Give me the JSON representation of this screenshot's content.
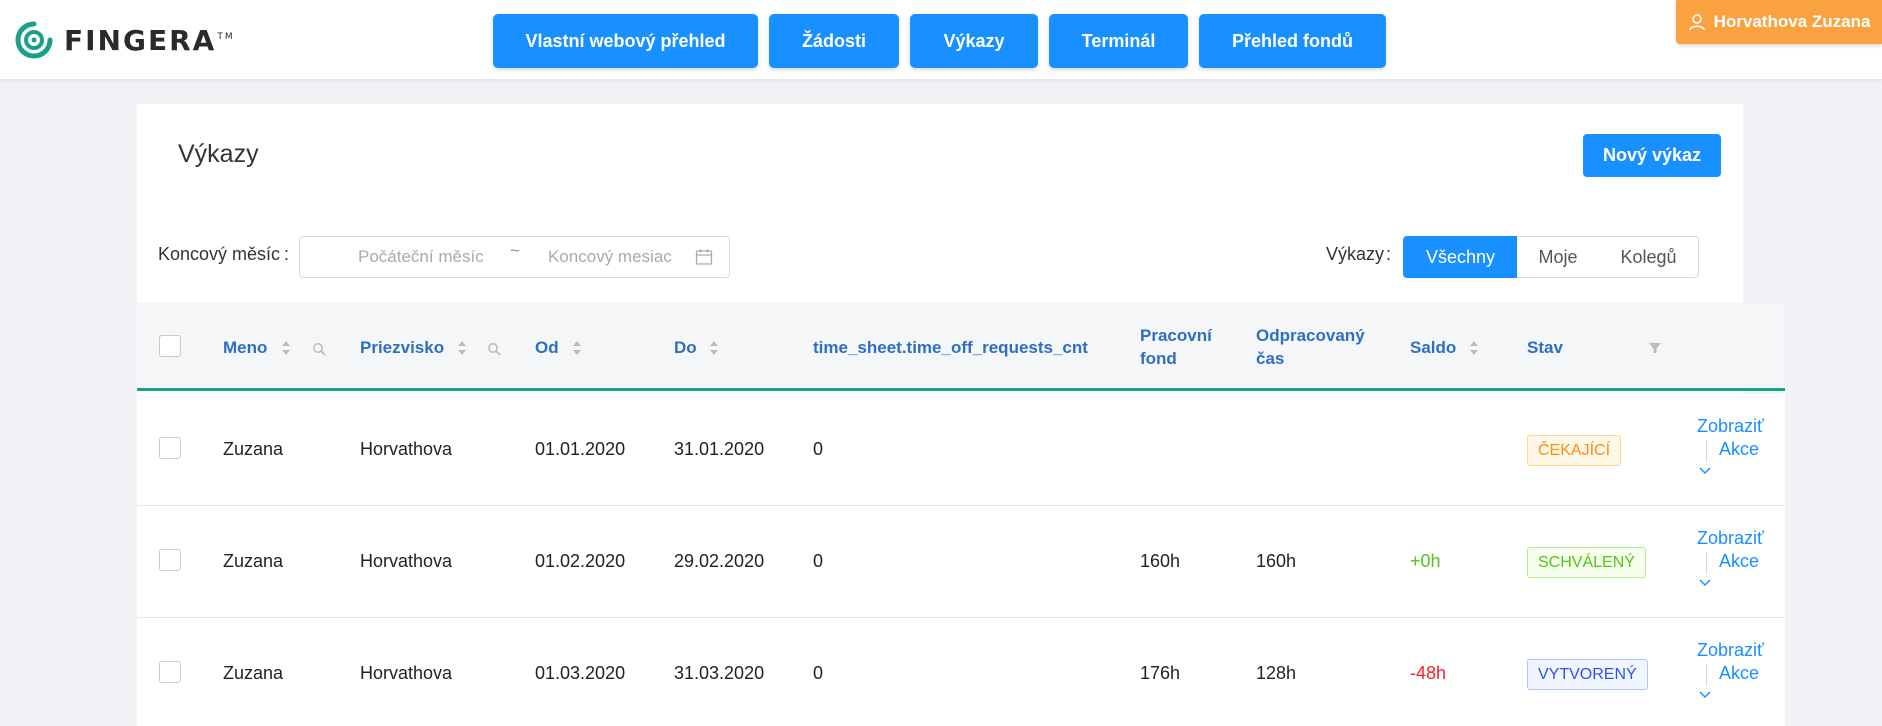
{
  "header": {
    "logo_text": "FINGERA",
    "logo_tm": "TM",
    "nav": [
      "Vlastní webový přehled",
      "Žádosti",
      "Výkazy",
      "Terminál",
      "Přehled fondů"
    ],
    "user": "Horvathova Zuzana"
  },
  "page": {
    "title": "Výkazy",
    "new_button": "Nový výkaz"
  },
  "filters": {
    "end_month_label": "Koncový měsíc",
    "colon": ":",
    "start_placeholder": "Počáteční měsíc",
    "separator": "~",
    "end_placeholder": "Koncový mesiac",
    "vykazy_label": "Výkazy",
    "segments": [
      "Všechny",
      "Moje",
      "Kolegů"
    ],
    "active_segment": "Všechny"
  },
  "table": {
    "columns": {
      "meno": "Meno",
      "priezvisko": "Priezvisko",
      "od": "Od",
      "do": "Do",
      "requests": "time_sheet.time_off_requests_cnt",
      "fond_1": "Pracovní",
      "fond_2": "fond",
      "cas_1": "Odpracovaný",
      "cas_2": "čas",
      "saldo": "Saldo",
      "stav": "Stav"
    },
    "rows": [
      {
        "meno": "Zuzana",
        "priezvisko": "Horvathova",
        "od": "01.01.2020",
        "do": "31.01.2020",
        "requests": "0",
        "fond": "",
        "cas": "",
        "saldo": "",
        "stav": "ČEKAJÍCÍ",
        "show": "Zobraziť",
        "actions": "Akce"
      },
      {
        "meno": "Zuzana",
        "priezvisko": "Horvathova",
        "od": "01.02.2020",
        "do": "29.02.2020",
        "requests": "0",
        "fond": "160h",
        "cas": "160h",
        "saldo": "+0h",
        "stav": "SCHVÁLENÝ",
        "show": "Zobraziť",
        "actions": "Akce"
      },
      {
        "meno": "Zuzana",
        "priezvisko": "Horvathova",
        "od": "01.03.2020",
        "do": "31.03.2020",
        "requests": "0",
        "fond": "176h",
        "cas": "128h",
        "saldo": "-48h",
        "stav": "VYTVORENÝ",
        "show": "Zobraziť",
        "actions": "Akce"
      }
    ]
  },
  "colors": {
    "primary": "#1890ff",
    "user_button": "#faa23f",
    "header_rule": "#17a589",
    "positive": "#52c41a",
    "negative": "#f5222d"
  },
  "icons": [
    "fingera-logo-icon",
    "user-icon",
    "calendar-icon",
    "sort-icon",
    "search-icon",
    "filter-icon",
    "chevron-down-icon"
  ]
}
